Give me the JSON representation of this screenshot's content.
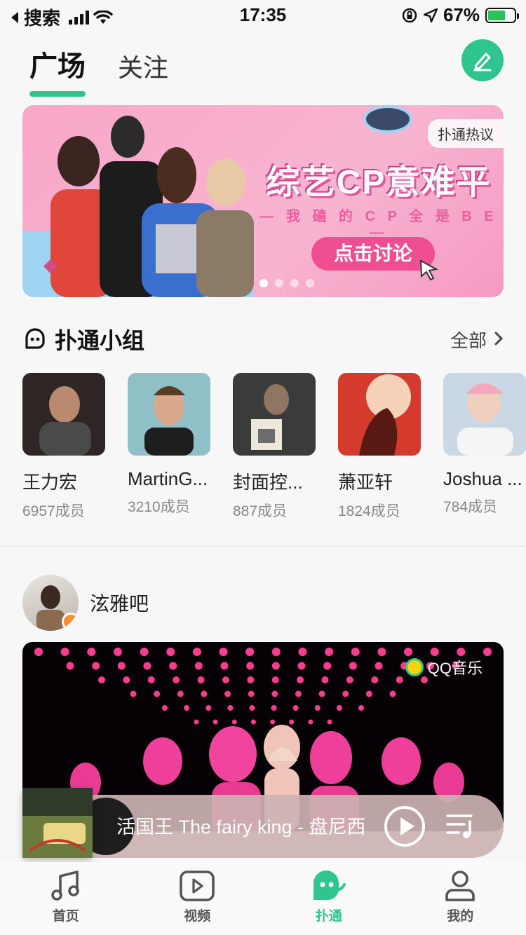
{
  "status_bar": {
    "back_app": "搜索",
    "time": "17:35",
    "battery": "67%",
    "battery_level": 0.67
  },
  "header": {
    "tabs": [
      {
        "label": "广场",
        "active": true
      },
      {
        "label": "关注",
        "active": false
      }
    ],
    "edit_icon": "pen-icon",
    "accent": "#2fc58f"
  },
  "banner": {
    "tag": "扑通热议",
    "headline": "综艺CP意难平",
    "subtitle": "— 我 磕 的 C P 全 是 B E —",
    "cta": "点击讨论",
    "page_count": 4,
    "active_page": 1
  },
  "groups_section": {
    "title": "扑通小组",
    "more": "全部",
    "items": [
      {
        "name": "王力宏",
        "members": "6957成员",
        "color": "#3a3230"
      },
      {
        "name": "MartinG...",
        "members": "3210成员",
        "color": "#7fb7c0"
      },
      {
        "name": "封面控...",
        "members": "887成员",
        "color": "#444444"
      },
      {
        "name": "萧亚轩",
        "members": "1824成员",
        "color": "#d9452e"
      },
      {
        "name": "Joshua ...",
        "members": "784成员",
        "color": "#c6d6e6"
      }
    ]
  },
  "post": {
    "author": "泫雅吧",
    "watermark": "QQ音乐"
  },
  "player": {
    "song": "活国王 The fairy king - 盘尼西"
  },
  "tabbar": {
    "items": [
      {
        "label": "首页",
        "icon": "music-note-icon",
        "active": false
      },
      {
        "label": "视频",
        "icon": "video-play-icon",
        "active": false
      },
      {
        "label": "扑通",
        "icon": "putong-face-icon",
        "active": true
      },
      {
        "label": "我的",
        "icon": "profile-icon",
        "active": false
      }
    ]
  }
}
